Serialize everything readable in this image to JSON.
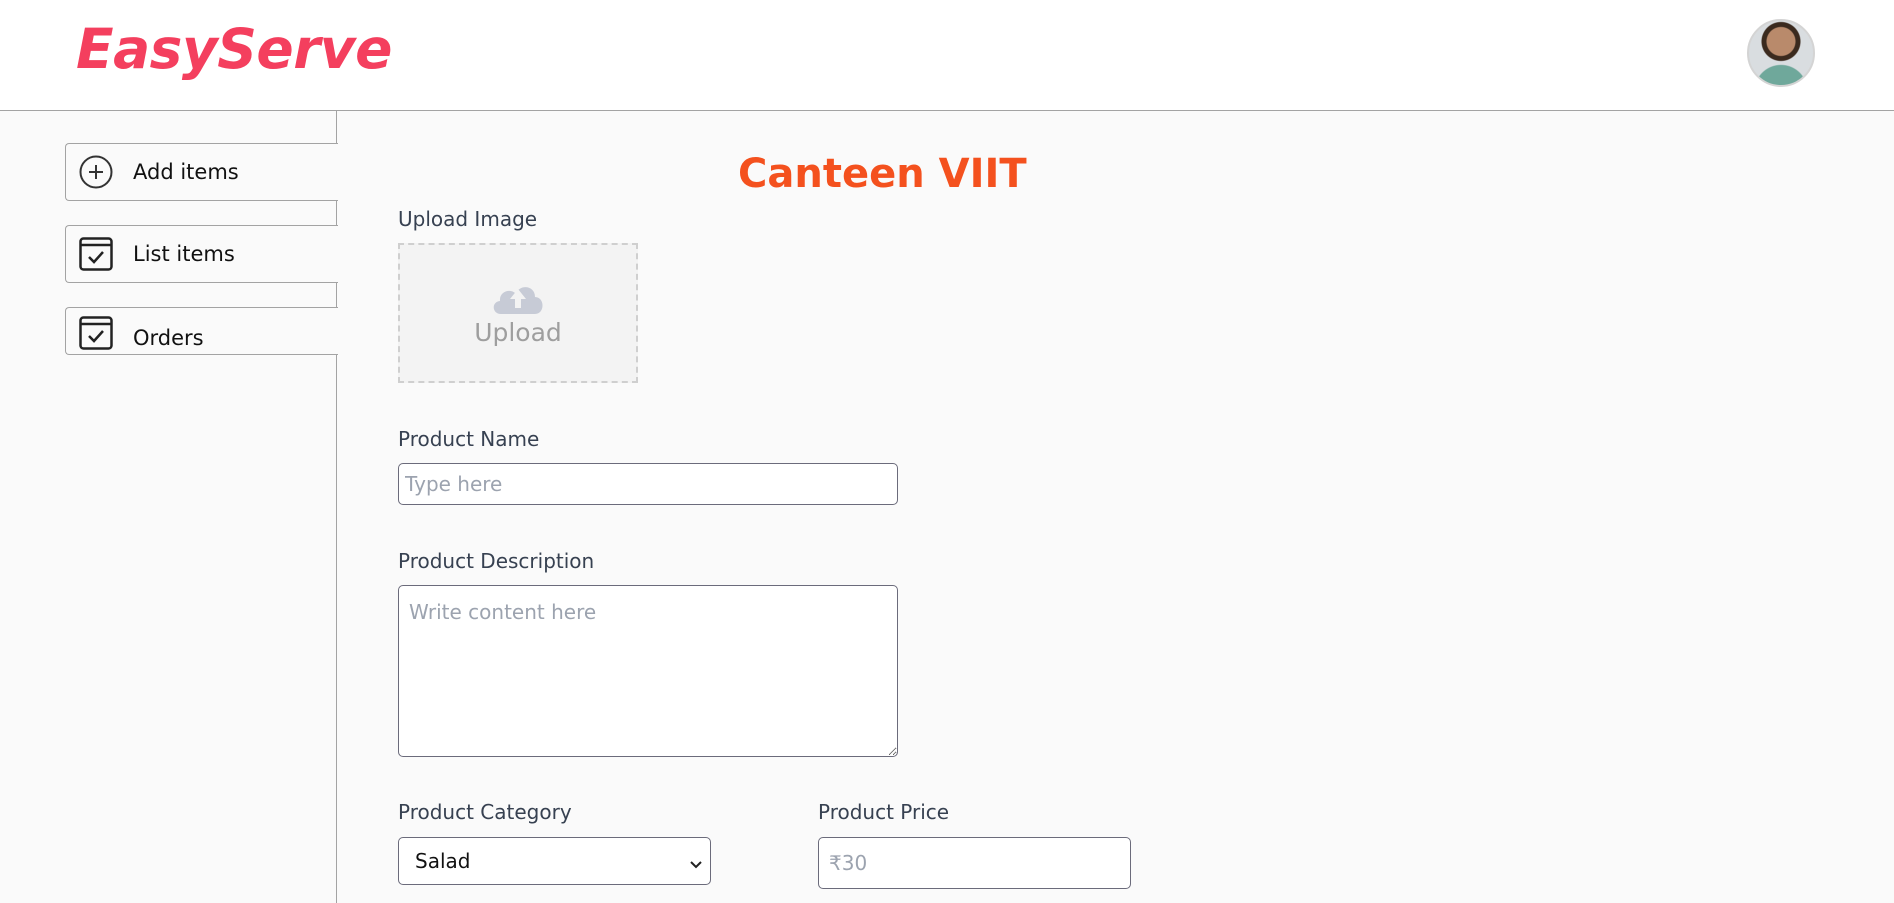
{
  "header": {
    "brand": "EasyServe",
    "avatar_icon": "user-avatar"
  },
  "sidebar": {
    "items": [
      {
        "label": "Add items",
        "icon": "add-circle-icon"
      },
      {
        "label": "List items",
        "icon": "checkbox-icon"
      },
      {
        "label": "Orders",
        "icon": "checkbox-icon"
      }
    ]
  },
  "main": {
    "title": "Canteen VIIT",
    "upload": {
      "label": "Upload Image",
      "text": "Upload",
      "icon": "cloud-upload-icon"
    },
    "product_name": {
      "label": "Product Name",
      "placeholder": "Type here"
    },
    "product_description": {
      "label": "Product Description",
      "placeholder": "Write content here"
    },
    "product_category": {
      "label": "Product Category",
      "value": "Salad"
    },
    "product_price": {
      "label": "Product Price",
      "placeholder": "₹30"
    }
  },
  "colors": {
    "brand": "#f43f5e",
    "title": "#f4511e",
    "border": "#a3a3a3"
  }
}
